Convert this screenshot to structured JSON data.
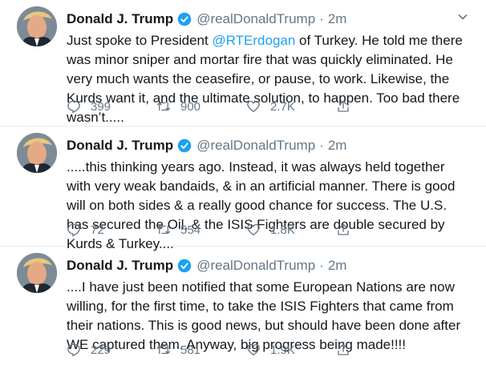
{
  "tweets": [
    {
      "name": "Donald J. Trump",
      "handle": "@realDonaldTrump",
      "sep": "·",
      "time": "2m",
      "text_before": "Just spoke to President ",
      "mention": "@RTErdogan",
      "text_after": " of Turkey. He told me there was minor sniper and mortar fire that was quickly eliminated. He very much wants the ceasefire, or pause, to work. Likewise, the Kurds want it, and the ultimate solution, to happen. Too bad there wasn’t.....",
      "replies": "399",
      "retweets": "900",
      "likes": "2.7K"
    },
    {
      "name": "Donald J. Trump",
      "handle": "@realDonaldTrump",
      "sep": "·",
      "time": "2m",
      "text_before": ".....this thinking years ago. Instead, it was always held together with very weak bandaids, & in an artificial manner. There is good will on both sides & a really good chance for success. The U.S. has secured the Oil, & the ISIS Fighters are double secured by Kurds & Turkey....",
      "mention": "",
      "text_after": "",
      "replies": "72",
      "retweets": "554",
      "likes": "1.8K"
    },
    {
      "name": "Donald J. Trump",
      "handle": "@realDonaldTrump",
      "sep": "·",
      "time": "2m",
      "text_before": "....I have just been notified that some European Nations are now willing, for the first time, to take the ISIS Fighters that came from their nations. This is good news, but should have been done after WE captured them. Anyway, big progress being made!!!!",
      "mention": "",
      "text_after": "",
      "replies": "229",
      "retweets": "581",
      "likes": "1.9K"
    }
  ],
  "colors": {
    "text": "#14171a",
    "secondary": "#657786",
    "link": "#1da1f2",
    "border": "#e6ecf0"
  },
  "icons": [
    "verified-badge-icon",
    "chevron-down-icon",
    "reply-icon",
    "retweet-icon",
    "like-icon",
    "share-icon"
  ]
}
